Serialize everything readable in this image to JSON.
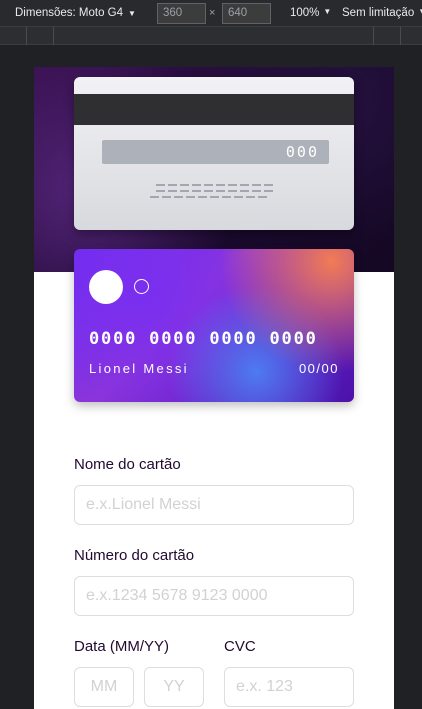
{
  "devtools": {
    "dimensions_label": "Dimensões: Moto G4",
    "width_value": "360",
    "height_value": "640",
    "times": "×",
    "zoom": "100%",
    "throttling": "Sem limitação",
    "caret": "▼"
  },
  "card_back": {
    "cvc": "000"
  },
  "card_front": {
    "number": "0000 0000 0000 0000",
    "holder": "Lionel Messi",
    "expiry": "00/00"
  },
  "form": {
    "name_label": "Nome do cartão",
    "name_placeholder": "e.x.Lionel Messi",
    "number_label": "Número do cartão",
    "number_placeholder": "e.x.1234 5678 9123 0000",
    "date_label": "Data (MM/YY)",
    "month_placeholder": "MM",
    "year_placeholder": "YY",
    "cvc_label": "CVC",
    "cvc_placeholder": "e.x. 123"
  },
  "colors": {
    "text_dark": "#21092f",
    "input_border": "#dedddf",
    "placeholder": "#d2d1d4",
    "hero_bg": "#1c0a30"
  }
}
